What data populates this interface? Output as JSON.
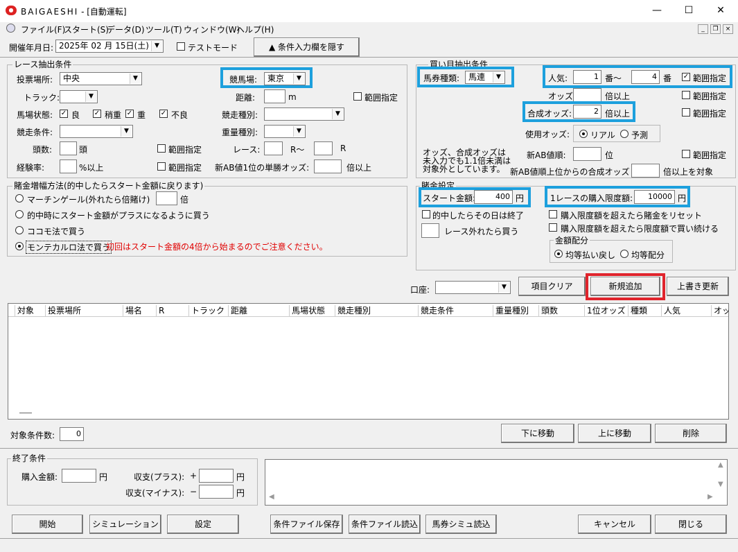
{
  "window": {
    "app_title": "BAIGAESHI",
    "doc_title": " - [自動運転]",
    "min": "—",
    "max": "☐",
    "close": "✕"
  },
  "menu": {
    "items": [
      "ファイル(F)",
      "スタート(S)",
      "データ(D)",
      "ツール(T)",
      "ウィンドウ(W)",
      "ヘルプ(H)"
    ],
    "mdi_min": "_",
    "mdi_restore": "❐",
    "mdi_close": "×"
  },
  "top": {
    "date_label": "開催年月日:",
    "date_value": "2025年 02 月 15日(土)",
    "test_mode": "テストモード",
    "hide_button": "▲ 条件入力欄を隠す"
  },
  "race": {
    "title": "レース抽出条件",
    "venue_label": "投票場所:",
    "venue_value": "中央",
    "course_label": "競馬場:",
    "course_value": "東京",
    "track_label": "トラック:",
    "distance_label": "距離:",
    "distance_unit": "m",
    "range": "範囲指定",
    "condition_label": "馬場状態:",
    "cond": [
      "良",
      "稍重",
      "重",
      "不良"
    ],
    "race_type_label": "競走種別:",
    "race_cond_label": "競走条件:",
    "weight_label": "重量種別:",
    "heads_label": "頭数:",
    "heads_unit": "頭",
    "race_label": "レース:",
    "race_unit1": "R〜",
    "race_unit2": "R",
    "exp_label": "経験率:",
    "exp_unit": "%以上",
    "ab_label": "新AB値1位の単勝オッズ:",
    "ab_unit": "倍以上"
  },
  "bet": {
    "title": "賭金増幅方法(的中したらスタート金額に戻ります)",
    "opt1": "マーチンゲール(外れたら倍賭け)",
    "opt1_unit": "倍",
    "opt2": "的中時にスタート金額がプラスになるように買う",
    "opt3": "ココモ法で買う",
    "opt4": "モンテカルロ法で買う",
    "note": "初回はスタート金額の4倍から始まるのでご注意ください。"
  },
  "buy": {
    "title": "買い目抽出条件",
    "ticket_label": "馬券種類:",
    "ticket_value": "馬連",
    "pop_label": "人気:",
    "pop_from": "1",
    "pop_mid": "番〜",
    "pop_to": "4",
    "pop_unit": "番",
    "odds_label": "オッズ:",
    "odds_unit": "倍以上",
    "comb_label": "合成オッズ:",
    "comb_value": "2",
    "comb_unit": "倍以上",
    "use_label": "使用オッズ:",
    "real": "リアル",
    "forecast": "予測",
    "note": "オッズ、合成オッズは\n未入力でも1.1倍未満は\n対象外としています。",
    "ab_rank_label": "新AB値順:",
    "ab_rank_unit": "位",
    "ab_comb_label": "新AB値順上位からの合成オッズ",
    "ab_comb_unit": "倍以上を対象",
    "range": "範囲指定"
  },
  "money": {
    "title": "賭金設定",
    "start_label": "スタート金額:",
    "start_value": "400",
    "yen": "円",
    "limit_label": "1レースの購入限度額:",
    "limit_value": "10000",
    "stop": "的中したらその日は終了",
    "reset": "購入限度額を超えたら賭金をリセット",
    "keep": "購入限度額を超えたら限度額で買い続ける",
    "skip": "レース外れたら買う",
    "dist_title": "金額配分",
    "even_return": "均等払い戻し",
    "even_split": "均等配分"
  },
  "actions": {
    "account_label": "口座:",
    "clear": "項目クリア",
    "add": "新規追加",
    "update": "上書き更新"
  },
  "table": {
    "headers": [
      "対象",
      "投票場所",
      "場名",
      "R",
      "トラック",
      "距離",
      "馬場状態",
      "競走種別",
      "競走条件",
      "重量種別",
      "頭数",
      "1位オッズ",
      "種類",
      "人気",
      "オッ"
    ]
  },
  "list_ops": {
    "count_label": "対象条件数:",
    "count_value": "0",
    "down": "下に移動",
    "up": "上に移動",
    "delete": "削除"
  },
  "end": {
    "title": "終了条件",
    "buy_label": "購入金額:",
    "plus_label": "収支(プラス):",
    "plus_sign": "+",
    "minus_label": "収支(マイナス):",
    "minus_sign": "−",
    "yen": "円"
  },
  "bottom": {
    "start": "開始",
    "sim": "シミュレーション",
    "settings": "設定",
    "save": "条件ファイル保存",
    "load": "条件ファイル読込",
    "ticket_sim": "馬券シミュ読込",
    "cancel": "キャンセル",
    "close": "閉じる"
  },
  "colors": {
    "highlight": "#1da0dd",
    "add_highlight": "#e0242c",
    "note_red": "#e00000"
  }
}
